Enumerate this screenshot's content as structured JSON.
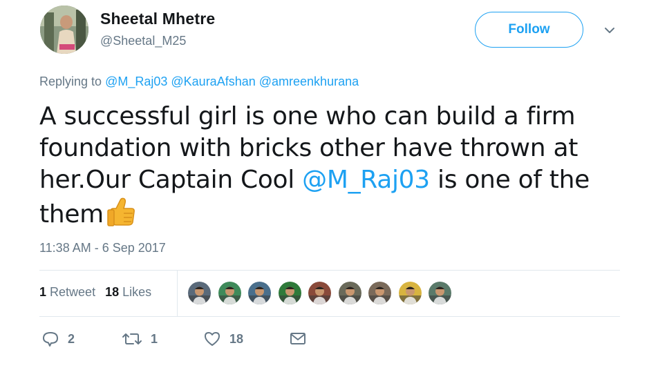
{
  "user": {
    "display_name": "Sheetal Mhetre",
    "handle": "@Sheetal_M25"
  },
  "follow_label": "Follow",
  "replying": {
    "prefix": "Replying to ",
    "mentions": [
      "@M_Raj03",
      "@KauraAfshan",
      "@amreenkhurana"
    ]
  },
  "tweet": {
    "text_before": "A successful girl is one who can build a firm foundation with bricks other have thrown at her.Our Captain Cool ",
    "mention": "@M_Raj03",
    "text_after": " is one of the them",
    "emoji": "thumbs-up-icon"
  },
  "timestamp": "11:38 AM - 6 Sep 2017",
  "stats": {
    "retweets_count": "1",
    "retweets_label": "Retweet",
    "likes_count": "18",
    "likes_label": "Likes"
  },
  "liker_avatar_colors": [
    "#5a6a7a",
    "#3f8a5a",
    "#4a6f8c",
    "#2f7a3a",
    "#8a4a3a",
    "#6a6a5a",
    "#7a6a5a",
    "#d8b440",
    "#5a7a6a"
  ],
  "actions": {
    "reply_count": "2",
    "retweet_count": "1",
    "like_count": "18"
  },
  "colors": {
    "accent": "#1da1f2",
    "secondary_text": "#657786",
    "primary_text": "#14171a"
  }
}
